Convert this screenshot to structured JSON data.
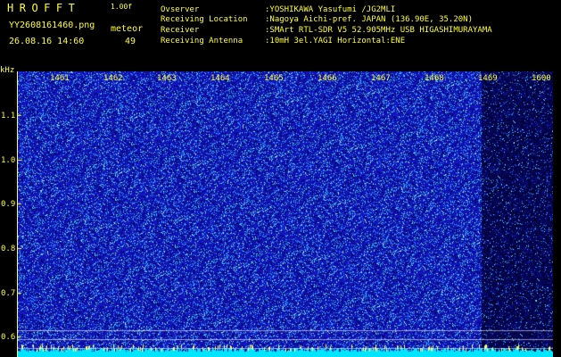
{
  "header": {
    "title": "HROFFT",
    "version": "1.00f",
    "file_name": "YY2608161460.png",
    "timestamp": "26.08.16 14:60",
    "meteor_label": "meteor",
    "meteor_count": "49"
  },
  "station_info": [
    {
      "key": "Ovserver",
      "value": ":YOSHIKAWA Yasufumi /JG2MLI"
    },
    {
      "key": "Receiving Location",
      "value": ":Nagoya Aichi-pref. JAPAN (136.90E, 35.20N)"
    },
    {
      "key": "Receiver",
      "value": ":SMArt RTL-SDR V5 52.905MHz USB HIGASHIMURAYAMA"
    },
    {
      "key": "Receiving Antenna",
      "value": ":10mH 3el.YAGI Horizontal:ENE"
    }
  ],
  "axis": {
    "y_unit": "kHz",
    "x_ticks": [
      "1461",
      "1462",
      "1463",
      "1464",
      "1465",
      "1466",
      "1467",
      "1468",
      "1469",
      "1600"
    ],
    "y_ticks": [
      "1.1",
      "1.0",
      "0.9",
      "0.8",
      "0.7",
      "0.6"
    ]
  },
  "colors": {
    "text": "#ffff33",
    "background": "#000000",
    "spectrum_base": "#1a1ab4",
    "noise_floor": "#00e5ff",
    "grid": "#ffffff"
  }
}
